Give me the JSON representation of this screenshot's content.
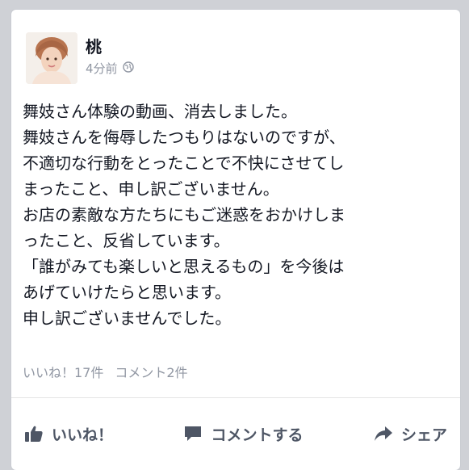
{
  "post": {
    "author": "桃",
    "time": "4分前",
    "lines": [
      "舞妓さん体験の動画、消去しました。",
      "舞妓さんを侮辱したつもりはないのですが、",
      "不適切な行動をとったことで不快にさせてし",
      "まったこと、申し訳ございません。",
      "お店の素敵な方たちにもご迷惑をおかけしま",
      "ったこと、反省しています。",
      "「誰がみても楽しいと思えるもの」を今後は",
      "あげていけたらと思います。",
      "申し訳ございませんでした。"
    ],
    "likes_text": "いいね！17件",
    "comments_text": "コメント2件"
  },
  "actions": {
    "like": "いいね！",
    "comment": "コメントする",
    "share": "シェア"
  },
  "icons": {
    "privacy": "globe-icon",
    "like": "thumbs-up-icon",
    "comment": "comment-bubble-icon",
    "share": "share-arrow-icon"
  },
  "colors": {
    "background": "#cfd1d6",
    "card": "#ffffff",
    "text": "#141823",
    "muted": "#9197a3",
    "action": "#4e5665"
  }
}
